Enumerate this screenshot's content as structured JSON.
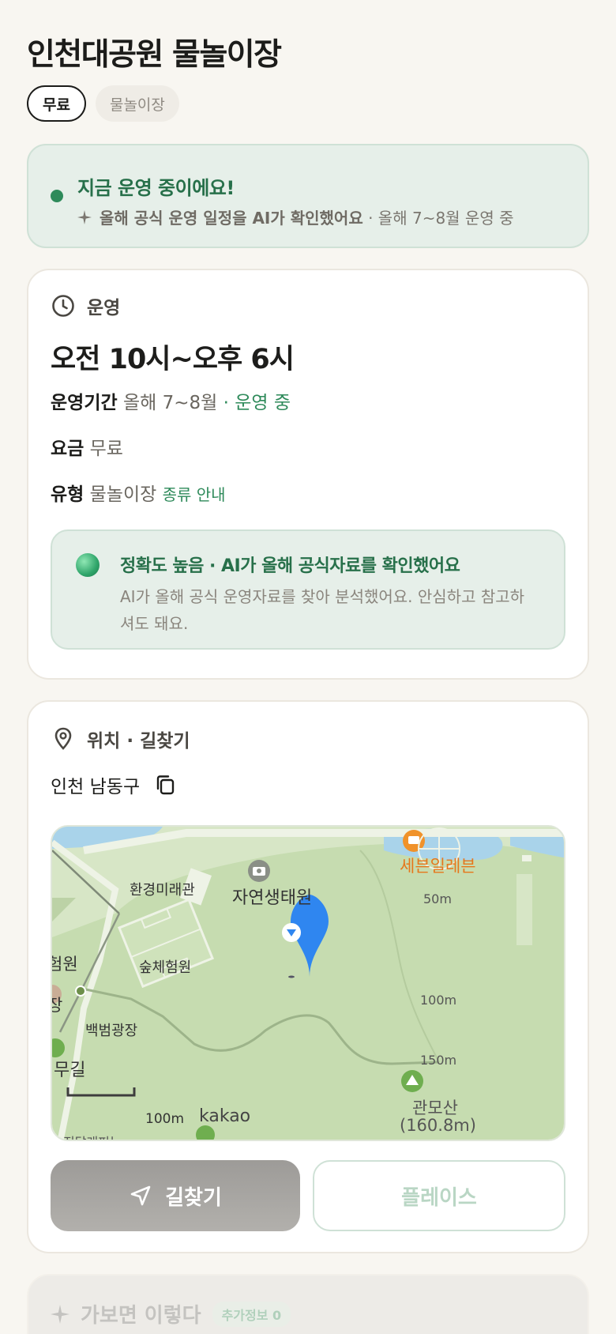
{
  "title": "인천대공원 물놀이장",
  "chips": [
    "무료",
    "물놀이장"
  ],
  "status": {
    "headline": "지금 운영 중이에요!",
    "sub_bold": "올해 공식 운영 일정을 AI가 확인했어요",
    "sub_rest": "· 올해 7~8월 운영 중"
  },
  "operation": {
    "section_label": "운영",
    "hours": "오전 10시~오후 6시",
    "period_key": "운영기간",
    "period_value": "올해 7~8월",
    "period_status": "· 운영 중",
    "fee_key": "요금",
    "fee_value": "무료",
    "type_key": "유형",
    "type_value": "물놀이장",
    "type_link": "종류 안내",
    "ai_title": "정확도 높음 · AI가 올해 공식자료를 확인했어요",
    "ai_desc": "AI가 올해 공식 운영자료를 찾아 분석했어요. 안심하고 참고하셔도 돼요."
  },
  "location": {
    "section_label": "위치 · 길찾기",
    "address": "인천 남동구",
    "map": {
      "labels": {
        "museum": "환경미래관",
        "eco": "자연생태원",
        "seven": "세븐일레븐",
        "forest": "숲체험원",
        "plaza": "백범광장",
        "left1": "험원",
        "left2": "장",
        "left3": "무길",
        "mountain": "관모산",
        "mountain_height": "(160.8m)",
        "contour50": "50m",
        "contour100": "100m",
        "contour150": "150m",
        "scale": "100m",
        "brand": "kakao",
        "bottom_cut": "진달래피는"
      }
    },
    "route_button": "길찾기",
    "place_button": "플레이스"
  },
  "more": {
    "title": "가보면 이렇다",
    "tag": "추가정보 0"
  },
  "colors": {
    "accent_green": "#2e8a5a",
    "status_bg": "#e6efe9",
    "map_green": "#c6dcb0"
  }
}
